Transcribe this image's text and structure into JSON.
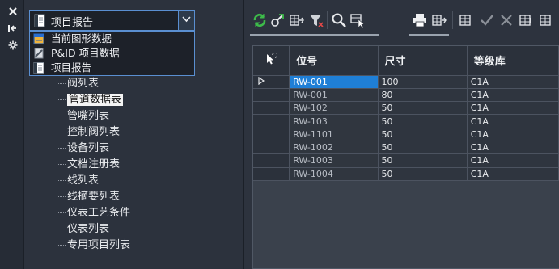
{
  "side_strip": {
    "buttons": [
      {
        "icon": "close-icon",
        "glyph": "✕"
      },
      {
        "icon": "dock-icon",
        "glyph": "⇤"
      },
      {
        "icon": "gear-icon",
        "glyph": "✱"
      }
    ]
  },
  "combo": {
    "selected": "项目报告",
    "options": [
      {
        "label": "当前图形数据",
        "icon": "drawing-data-icon"
      },
      {
        "label": "P&ID 项目数据",
        "icon": "pid-project-data-icon"
      },
      {
        "label": "项目报告",
        "icon": "report-icon"
      }
    ]
  },
  "tree": {
    "items": [
      "阀列表",
      "管道数据表",
      "管嘴列表",
      "控制阀列表",
      "设备列表",
      "文档注册表",
      "线列表",
      "线摘要列表",
      "仪表工艺条件",
      "仪表列表",
      "专用项目列表"
    ],
    "selected_index": 1
  },
  "toolbar": {
    "icons": [
      "refresh-icon",
      "locate-icon",
      "export-grid-icon",
      "filter-icon",
      "zoom-icon",
      "select-icon",
      "print-icon",
      "import-grid-icon",
      "accept-grid-icon",
      "accept-check-icon",
      "reject-x-icon",
      "sync-grid-icon",
      "more-grid-icon"
    ]
  },
  "grid": {
    "columns": [
      "位号",
      "尺寸",
      "等级库"
    ],
    "rows": [
      {
        "tag": "RW-001",
        "size": "100",
        "spec": "C1A"
      },
      {
        "tag": "RW-001",
        "size": "80",
        "spec": "C1A"
      },
      {
        "tag": "RW-102",
        "size": "50",
        "spec": "C1A"
      },
      {
        "tag": "RW-103",
        "size": "50",
        "spec": "C1A"
      },
      {
        "tag": "RW-1101",
        "size": "50",
        "spec": "C1A"
      },
      {
        "tag": "RW-1002",
        "size": "50",
        "spec": "C1A"
      },
      {
        "tag": "RW-1003",
        "size": "50",
        "spec": "C1A"
      },
      {
        "tag": "RW-1004",
        "size": "50",
        "spec": "C1A"
      }
    ],
    "active_row_index": 0
  },
  "colors": {
    "accent": "#1f7fd6",
    "combo_border": "#5a8fd1",
    "panel_bg": "#2c323d",
    "refresh_green": "#3dbb4a"
  }
}
